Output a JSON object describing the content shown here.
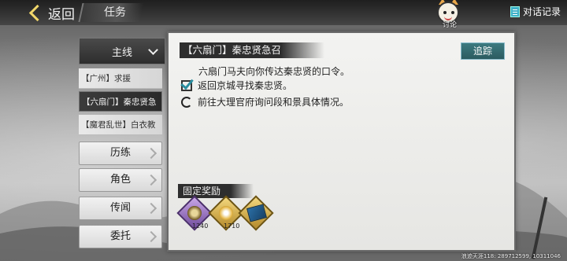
{
  "header": {
    "back_label": "返回",
    "tab_label": "任务",
    "discuss_label": "讨论",
    "dialog_log_label": "对话记录"
  },
  "sidebar": {
    "main_category": "主线",
    "quests": [
      {
        "label": "【广州】求援",
        "active": false
      },
      {
        "label": "【六扇门】秦忠贤急",
        "active": true
      },
      {
        "label": "【魔君乱世】白衣教",
        "active": false
      }
    ],
    "categories": [
      "历练",
      "角色",
      "传闻",
      "委托"
    ]
  },
  "quest": {
    "title": "【六扇门】秦忠贤急召",
    "track_label": "追踪",
    "description": "六扇门马夫向你传达秦忠贤的口令。",
    "steps": [
      {
        "text": "返回京城寻找秦忠贤。",
        "status": "done"
      },
      {
        "text": "前往大理官府询问段和景具体情况。",
        "status": "in-progress"
      }
    ]
  },
  "rewards": {
    "heading": "固定奖励",
    "items": [
      {
        "icon": "coin-icon",
        "quantity": "1240"
      },
      {
        "icon": "gold-coin-icon",
        "quantity": "1710"
      },
      {
        "icon": "book-icon",
        "quantity": ""
      }
    ]
  },
  "footer_text": "浪迹天涯118: 289712599, 10311046",
  "colors": {
    "accent_teal": "#2b5b60",
    "check_teal": "#2a8ea0",
    "gold": "#f0d66a"
  }
}
